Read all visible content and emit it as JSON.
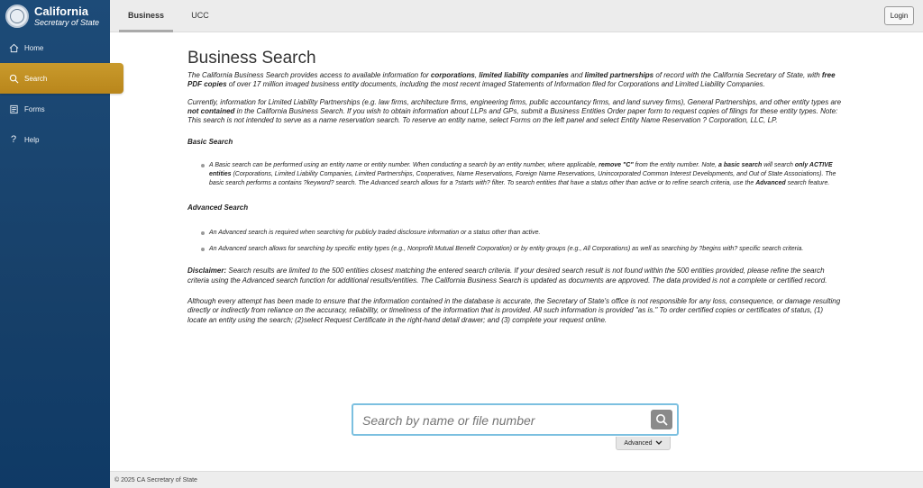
{
  "brand": {
    "title": "California",
    "subtitle": "Secretary of State"
  },
  "nav": [
    {
      "label": "Home",
      "icon": "home-icon"
    },
    {
      "label": "Search",
      "icon": "search-icon",
      "active": true
    },
    {
      "label": "Forms",
      "icon": "forms-icon"
    },
    {
      "label": "Help",
      "icon": "help-icon"
    }
  ],
  "tabs": {
    "business": "Business",
    "ucc": "UCC"
  },
  "header": {
    "login": "Login"
  },
  "main": {
    "title": "Business Search",
    "intro": {
      "a": "The California Business Search provides access to available information for ",
      "b": "corporations",
      "c": ", ",
      "d": "limited liability companies",
      "e": " and ",
      "f": "limited partnerships",
      "g": " of record with the California Secretary of State, with ",
      "h": "free PDF copies",
      "i": " of over 17 million imaged business entity documents, including the most recent imaged Statements of Information filed for Corporations and Limited Liability Companies."
    },
    "llp": {
      "a": "Currently, information for Limited Liability Partnerships (e.g. law firms, architecture firms, engineering firms, public accountancy firms, and land survey firms), General Partnerships, and other entity types are ",
      "b": "not contained",
      "c": " in the California Business Search. If you wish to obtain information about LLPs and GPs, submit a Business Entities Order paper form to request copies of filings for these entity types. Note: This search is not intended to serve as a name reservation search. To reserve an entity name, select Forms on the left panel and select Entity Name Reservation ? Corporation, LLC, LP."
    },
    "basic_heading": "Basic Search",
    "basic_bullet": {
      "a": "A Basic search can be performed using an entity name or entity number. When conducting a search by an entity number, where applicable, ",
      "b": "remove \"C\"",
      "c": " from the entity number. Note, ",
      "d": "a basic search",
      "e": " will search ",
      "f": "only ACTIVE entities",
      "g": " (Corporations, Limited Liability Companies, Limited Partnerships, Cooperatives, Name Reservations, Foreign Name Reservations, Unincorporated Common Interest Developments, and Out of State Associations). The basic search performs a contains ?keyword? search. The Advanced search allows for a ?starts with? filter. To search entities that have a status other than active or to refine search criteria, use the ",
      "h": "Advanced",
      "i": " search feature."
    },
    "advanced_heading": "Advanced Search",
    "advanced_bullets": [
      "An Advanced search is required when searching for publicly traded disclosure information or a status other than active.",
      "An Advanced search allows for searching by specific entity types (e.g., Nonprofit Mutual Benefit Corporation) or by entity groups (e.g., All Corporations) as well as searching by ?begins with? specific search criteria."
    ],
    "disclaimer": {
      "label": "Disclaimer:",
      "text": " Search results are limited to the 500 entities closest matching the entered search criteria. If your desired search result is not found within the 500 entities provided, please refine the search criteria using the Advanced search function for additional results/entities. The California Business Search is updated as documents are approved. The data provided is not a complete or certified record."
    },
    "liability": "Although every attempt has been made to ensure that the information contained in the database is accurate, the Secretary of State's office is not responsible for any loss, consequence, or damage resulting directly or indirectly from reliance on the accuracy, reliability, or timeliness of the information that is provided. All such information is provided \"as is.\" To order certified copies or certificates of status, (1) locate an entity using the search; (2)select Request Certificate in the right-hand detail drawer; and (3) complete your request online."
  },
  "search": {
    "placeholder": "Search by name or file number",
    "advanced": "Advanced"
  },
  "footer": {
    "text": "© 2025 CA Secretary of State"
  },
  "colors": {
    "sidebar": "#174069",
    "active": "#c99a2c",
    "search_border": "#7cc0e0"
  }
}
